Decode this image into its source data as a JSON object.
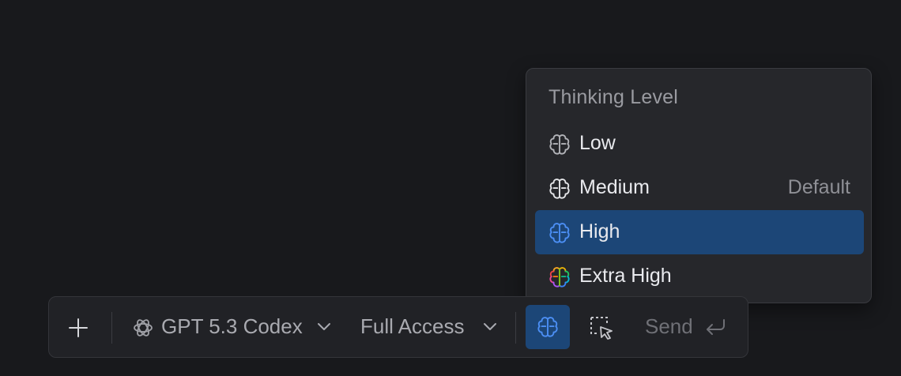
{
  "menu": {
    "title": "Thinking Level",
    "items": [
      {
        "label": "Low",
        "note": "",
        "icon": "brain-icon",
        "selected": false
      },
      {
        "label": "Medium",
        "note": "Default",
        "icon": "brain-icon",
        "selected": false
      },
      {
        "label": "High",
        "note": "",
        "icon": "brain-icon",
        "selected": true
      },
      {
        "label": "Extra High",
        "note": "",
        "icon": "brain-rainbow-icon",
        "selected": false
      }
    ]
  },
  "toolbar": {
    "model_label": "GPT 5.3 Codex",
    "access_label": "Full Access",
    "send_label": "Send"
  },
  "colors": {
    "background": "#18191c",
    "menu_background": "#26272b",
    "selected_background": "#1c4677",
    "accent_blue": "#3b82f6"
  }
}
